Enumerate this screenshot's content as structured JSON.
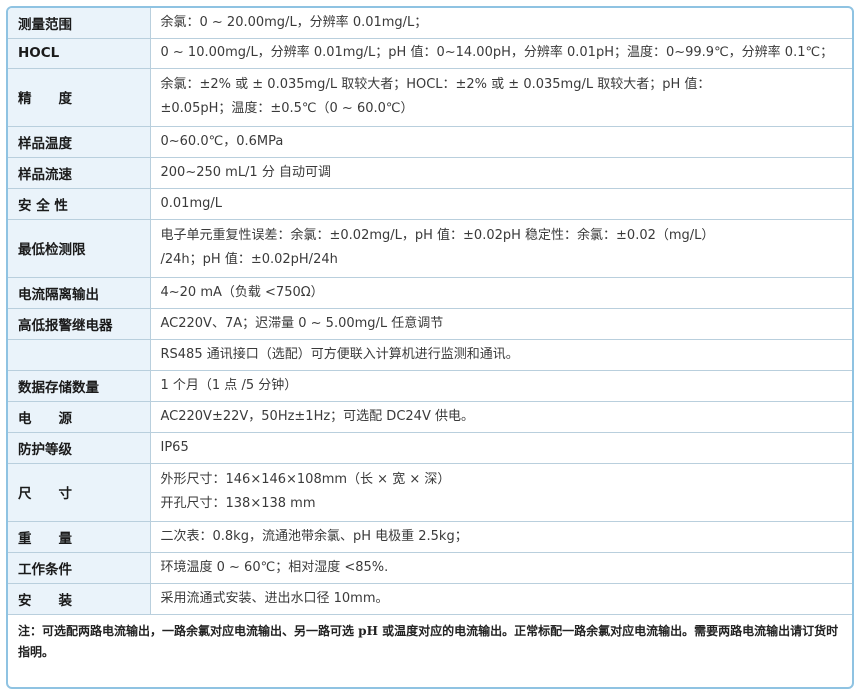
{
  "rows": [
    {
      "label": "测量范围",
      "lines": [
        "余氯：0 ~ 20.00mg/L，分辨率 0.01mg/L；"
      ]
    },
    {
      "label": "HOCL",
      "lines": [
        "0 ~ 10.00mg/L，分辨率 0.01mg/L；pH 值：0~14.00pH，分辨率 0.01pH；温度：0~99.9℃，分辨率 0.1℃；"
      ]
    },
    {
      "label": "精　　度",
      "lines": [
        "余氯：±2% 或 ± 0.035mg/L 取较大者；HOCL：±2% 或 ± 0.035mg/L 取较大者；pH 值：",
        "±0.05pH；温度：±0.5℃（0 ~ 60.0℃）"
      ]
    },
    {
      "label": "样品温度",
      "lines": [
        "0~60.0℃，0.6MPa"
      ]
    },
    {
      "label": "样品流速",
      "lines": [
        "200~250 mL/1 分 自动可调"
      ]
    },
    {
      "label": "安 全 性",
      "lines": [
        "0.01mg/L"
      ]
    },
    {
      "label": "最低检测限",
      "lines": [
        "电子单元重复性误差：余氯：±0.02mg/L，pH 值：±0.02pH 稳定性：余氯：±0.02（mg/L）",
        "/24h；pH 值：±0.02pH/24h"
      ]
    },
    {
      "label": "电流隔离输出",
      "lines": [
        "4~20 mA（负载 <750Ω）"
      ]
    },
    {
      "label": "高低报警继电器",
      "lines": [
        "AC220V、7A；迟滞量 0 ~ 5.00mg/L 任意调节"
      ]
    },
    {
      "label": "",
      "lines": [
        "RS485 通讯接口（选配）可方便联入计算机进行监测和通讯。"
      ]
    },
    {
      "label": "数据存储数量",
      "lines": [
        "1 个月（1 点 /5 分钟）"
      ]
    },
    {
      "label": "电　　源",
      "lines": [
        "AC220V±22V，50Hz±1Hz；可选配 DC24V 供电。"
      ]
    },
    {
      "label": "防护等级",
      "lines": [
        "IP65"
      ]
    },
    {
      "label": "尺　　寸",
      "lines": [
        "外形尺寸：146×146×108mm（长 × 宽 × 深）",
        "开孔尺寸：138×138 mm"
      ]
    },
    {
      "label": "重　　量",
      "lines": [
        "二次表：0.8kg，流通池带余氯、pH 电极重 2.5kg；"
      ]
    },
    {
      "label": "工作条件",
      "lines": [
        "环境温度 0 ~ 60℃；相对湿度 <85%."
      ]
    },
    {
      "label": "安　　装",
      "lines": [
        "采用流通式安装、进出水口径 10mm。"
      ]
    }
  ],
  "note": "注：可选配两路电流输出，一路余氯对应电流输出、另一路可选 pH 或温度对应的电流输出。正常标配一路余氯对应电流输出。需要两路电流输出请订货时指明。"
}
